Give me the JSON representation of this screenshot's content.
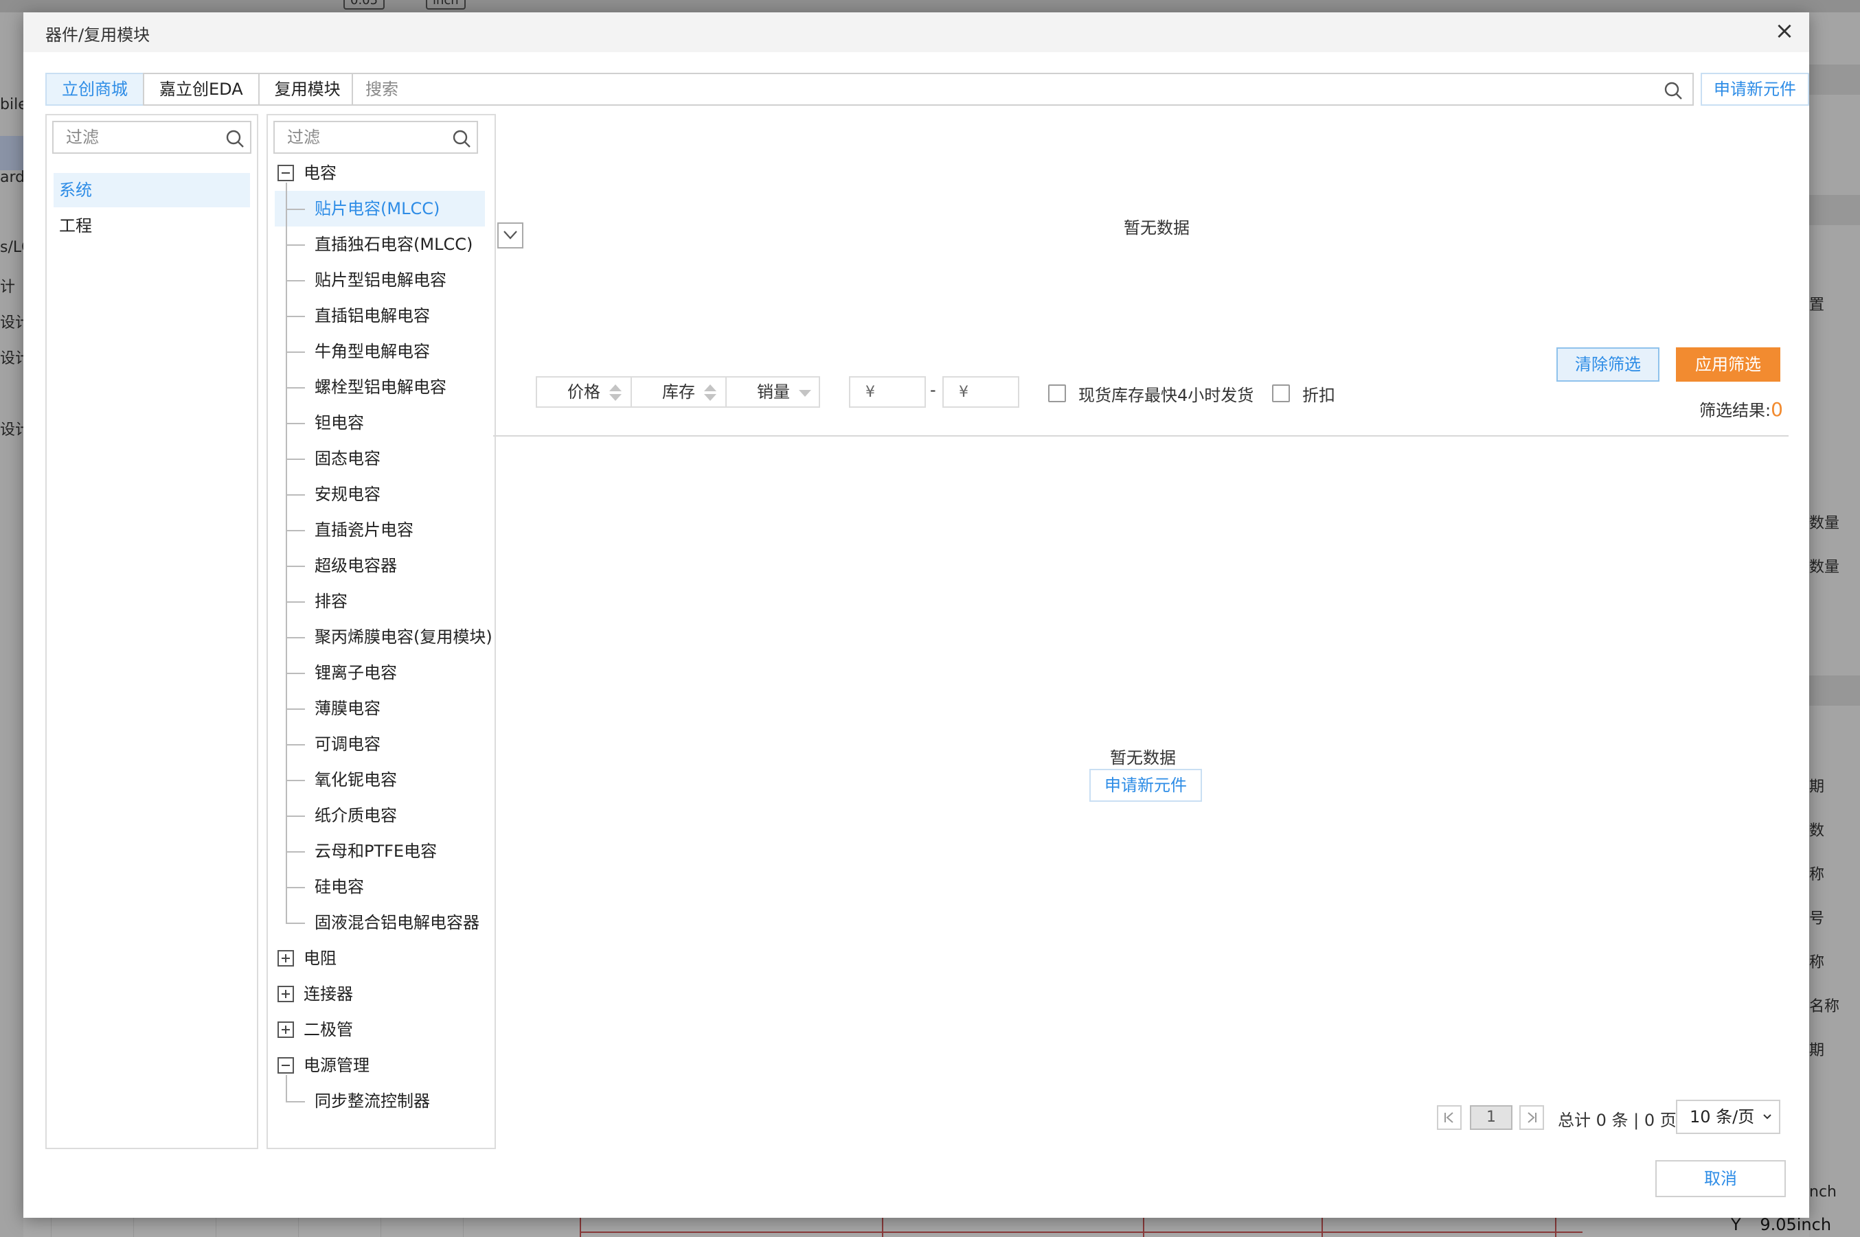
{
  "dialog": {
    "title": "器件/复用模块",
    "close_label": "×"
  },
  "tabs": [
    {
      "label": "立创商城",
      "active": true
    },
    {
      "label": "嘉立创EDA",
      "active": false
    },
    {
      "label": "复用模块",
      "active": false
    }
  ],
  "search": {
    "placeholder": "搜索",
    "value": ""
  },
  "apply_new_component": "申请新元件",
  "left_panel": {
    "filter_placeholder": "过滤",
    "items": [
      {
        "label": "系统",
        "selected": true
      },
      {
        "label": "工程",
        "selected": false
      }
    ]
  },
  "tree": {
    "filter_placeholder": "过滤",
    "roots": [
      {
        "label": "电容",
        "expanded": true,
        "children": [
          "贴片电容(MLCC)",
          "直插独石电容(MLCC)",
          "贴片型铝电解电容",
          "直插铝电解电容",
          "牛角型电解电容",
          "螺栓型铝电解电容",
          "钽电容",
          "固态电容",
          "安规电容",
          "直插瓷片电容",
          "超级电容器",
          "排容",
          "聚丙烯膜电容(复用模块)",
          "锂离子电容",
          "薄膜电容",
          "可调电容",
          "氧化铌电容",
          "纸介质电容",
          "云母和PTFE电容",
          "硅电容",
          "固液混合铝电解电容器"
        ],
        "selected_child": 0
      },
      {
        "label": "电阻",
        "expanded": false,
        "children": []
      },
      {
        "label": "连接器",
        "expanded": false,
        "children": []
      },
      {
        "label": "二极管",
        "expanded": false,
        "children": []
      },
      {
        "label": "电源管理",
        "expanded": true,
        "children": [
          "同步整流控制器"
        ]
      }
    ]
  },
  "filters": {
    "empty_text": "暂无数据",
    "sort_buttons": [
      "价格",
      "库存",
      "销量"
    ],
    "price_min_placeholder": "¥",
    "price_max_placeholder": "¥",
    "price_separator": "-",
    "checkbox_fast_ship": "现货库存最快4小时发货",
    "checkbox_discount": "折扣",
    "clear_label": "清除筛选",
    "apply_label": "应用筛选",
    "result_label": "筛选结果:",
    "result_count": "0"
  },
  "results": {
    "empty_text": "暂无数据",
    "apply_new_component": "申请新元件"
  },
  "pagination": {
    "current_page": "1",
    "summary": "总计 0 条 | 0 页",
    "page_size": "10 条/页"
  },
  "footer": {
    "cancel_label": "取消"
  },
  "background": {
    "toolbar_items": [
      "0.05",
      "inch"
    ],
    "left_fragments": [
      "bile",
      "ard",
      "s/LC",
      "计",
      "设计",
      "设计",
      "设计"
    ],
    "right_fragments": [
      "置",
      "数量",
      "数量",
      "期",
      "数",
      "称",
      "号",
      "称",
      "名称",
      "期",
      "nch"
    ],
    "coordinate_label": "Y",
    "coordinate_value": "9.05inch"
  },
  "colors": {
    "accent": "#2d8ce6",
    "accent_bg": "#e8f3fc",
    "orange": "#f28b30",
    "overlay": "#9a9a9a"
  }
}
